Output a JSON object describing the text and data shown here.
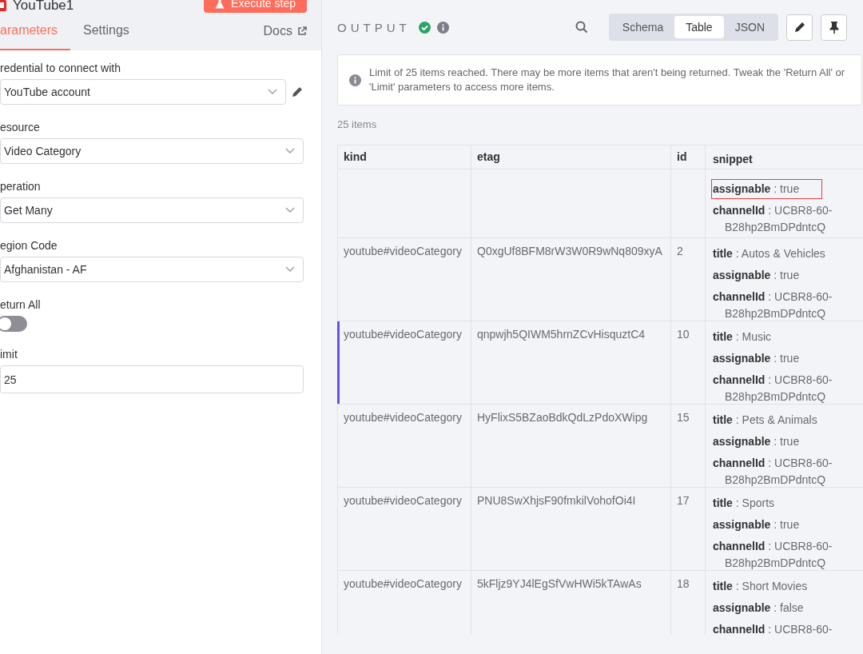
{
  "node": {
    "title": "YouTube1",
    "execute_button": "Execute step"
  },
  "tabs": [
    {
      "label": "arameters",
      "selected": true
    },
    {
      "label": "Settings",
      "selected": false
    }
  ],
  "docs_link": "Docs",
  "params": [
    {
      "kind": "select",
      "label": "redential to connect with",
      "value": "YouTube account",
      "editable": true
    },
    {
      "kind": "select",
      "label": "esource",
      "value": "Video Category",
      "editable": false
    },
    {
      "kind": "select",
      "label": "peration",
      "value": "Get Many",
      "editable": false
    },
    {
      "kind": "select",
      "label": "egion Code",
      "value": "Afghanistan - AF",
      "editable": false
    },
    {
      "kind": "toggle",
      "label": "eturn All",
      "on": false
    },
    {
      "kind": "input",
      "label": "imit",
      "value": "25"
    }
  ],
  "output": {
    "title": "OUTPUT",
    "success": true,
    "view_modes": [
      {
        "label": "Schema",
        "selected": false
      },
      {
        "label": "Table",
        "selected": true
      },
      {
        "label": "JSON",
        "selected": false
      }
    ],
    "notice": "Limit of 25 items reached. There may be more items that aren't being returned. Tweak the 'Return All' or 'Limit' parameters to access more items.",
    "count": "25 items",
    "table": {
      "columns": [
        "kind",
        "etag",
        "id",
        "snippet"
      ],
      "rows": [
        {
          "selected": false,
          "snippet": [
            {
              "text": "**assignable** : true",
              "highlighted": true
            },
            {
              "text": "**channelId** : UCBR8-60-B28hp2BmDPdntcQ",
              "highlighted": false
            }
          ]
        },
        {
          "kind": "youtube#videoCategory",
          "etag": "Q0xgUf8BFM8rW3W0R9wNq809xyA",
          "id": "2",
          "selected": false,
          "snippet": [
            {
              "text": "**title** : Autos & Vehicles",
              "highlighted": false
            },
            {
              "text": "**assignable** : true",
              "highlighted": false
            },
            {
              "text": "**channelId** : UCBR8-60-B28hp2BmDPdntcQ",
              "highlighted": false
            }
          ]
        },
        {
          "kind": "youtube#videoCategory",
          "etag": "qnpwjh5QIWM5hrnZCvHisquztC4",
          "id": "10",
          "selected": true,
          "snippet": [
            {
              "text": "**title** : Music",
              "highlighted": false
            },
            {
              "text": "**assignable** : true",
              "highlighted": false
            },
            {
              "text": "**channelId** : UCBR8-60-B28hp2BmDPdntcQ",
              "highlighted": false
            }
          ]
        },
        {
          "kind": "youtube#videoCategory",
          "etag": "HyFlixS5BZaoBdkQdLzPdoXWipg",
          "id": "15",
          "selected": false,
          "snippet": [
            {
              "text": "**title** : Pets & Animals",
              "highlighted": false
            },
            {
              "text": "**assignable** : true",
              "highlighted": false
            },
            {
              "text": "**channelId** : UCBR8-60-B28hp2BmDPdntcQ",
              "highlighted": false
            }
          ]
        },
        {
          "kind": "youtube#videoCategory",
          "etag": "PNU8SwXhjsF90fmkilVohofOi4I",
          "id": "17",
          "selected": false,
          "snippet": [
            {
              "text": "**title** : Sports",
              "highlighted": false
            },
            {
              "text": "**assignable** : true",
              "highlighted": false
            },
            {
              "text": "**channelId** : UCBR8-60-B28hp2BmDPdntcQ",
              "highlighted": false
            }
          ]
        },
        {
          "kind": "youtube#videoCategory",
          "etag": "5kFljz9YJ4lEgSfVwHWi5kTAwAs",
          "id": "18",
          "selected": false,
          "snippet": [
            {
              "text": "**title** : Short Movies",
              "highlighted": false
            },
            {
              "text": "**assignable** : false",
              "highlighted": false
            },
            {
              "text": "**channelId** : UCBR8-60-",
              "highlighted": false
            }
          ]
        }
      ]
    }
  }
}
